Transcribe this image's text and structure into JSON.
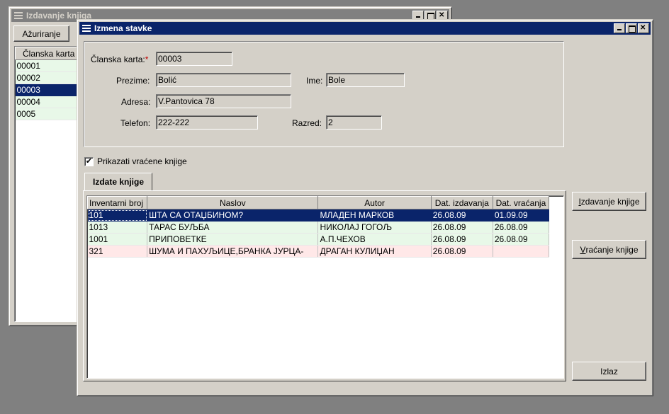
{
  "bg_window": {
    "title": "Izdavanje knjiga",
    "update_button": "Ažuriranje",
    "column_header": "Članska karta",
    "rows": [
      {
        "value": "00001",
        "style": "green"
      },
      {
        "value": "00002",
        "style": "green"
      },
      {
        "value": "00003",
        "style": "sel"
      },
      {
        "value": "00004",
        "style": "green"
      },
      {
        "value": "0005",
        "style": "green"
      }
    ]
  },
  "dialog": {
    "title": "Izmena stavke",
    "labels": {
      "member_card": "Članska karta:",
      "required_mark": "*",
      "surname": "Prezime:",
      "name": "Ime:",
      "address": "Adresa:",
      "phone": "Telefon:",
      "grade": "Razred:"
    },
    "values": {
      "member_card": "00003",
      "surname": "Bolić",
      "name": "Bole",
      "address": "V.Pantovica 78",
      "phone": "222-222",
      "grade": "2"
    },
    "show_returned_label": "Prikazati vraćene knjige",
    "show_returned_checked": "✔",
    "tab_label": "Izdate knjige",
    "columns": [
      "Inventarni broj",
      "Naslov",
      "Autor",
      "Dat. izdavanja",
      "Dat. vraćanja"
    ],
    "rows": [
      {
        "cells": [
          "101",
          " ШТА СА ОТАЏБИНОМ?",
          "МЛАДЕН МАРКОВ",
          "26.08.09",
          "01.09.09"
        ],
        "style": "sel"
      },
      {
        "cells": [
          "1013",
          "ТАРАС БУЉБА",
          "НИКОЛАЈ ГОГОЉ",
          "26.08.09",
          "26.08.09"
        ],
        "style": "green"
      },
      {
        "cells": [
          "1001",
          "ПРИПОВЕТКЕ",
          "А.П.ЧЕХОВ",
          "26.08.09",
          "26.08.09"
        ],
        "style": "green"
      },
      {
        "cells": [
          "321",
          "ШУМА И ПАХУЉИЦЕ,БРАНКА ЈУРЦА-",
          "ДРАГАН КУЛИЏАН",
          "26.08.09",
          ""
        ],
        "style": "pink"
      }
    ],
    "buttons": {
      "issue_prefix": "I",
      "issue_rest": "zdavanje knjige",
      "return_prefix": "V",
      "return_rest": "raćanje knjige",
      "exit": "Izlaz"
    }
  }
}
